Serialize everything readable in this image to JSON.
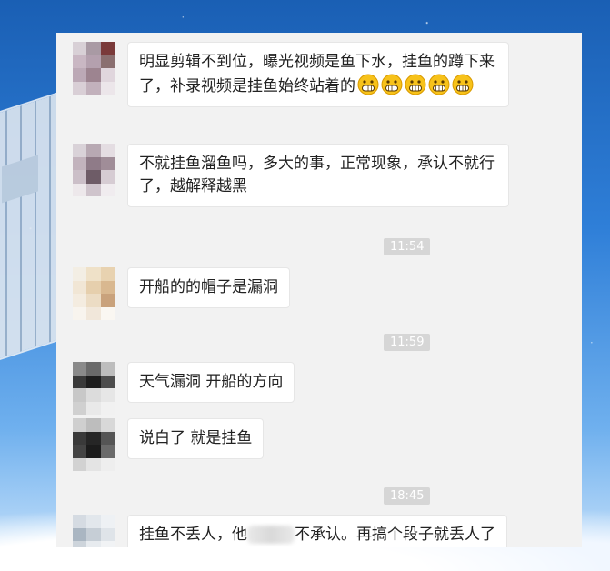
{
  "chat": {
    "messages": [
      {
        "text": "明显剪辑不到位，曝光视频是鱼下水，挂鱼的蹲下来了，补录视频是挂鱼始终站着的",
        "emoji": "grinning-face-emoji",
        "emoji_count": 5
      },
      {
        "text": "不就挂鱼溜鱼吗，多大的事，正常现象，承认不就行了，越解释越黑"
      },
      {
        "time": "11:54"
      },
      {
        "text": "开船的的帽子是漏洞"
      },
      {
        "time": "11:59"
      },
      {
        "text": "天气漏洞 开船的方向"
      },
      {
        "text": "说白了 就是挂鱼"
      },
      {
        "time": "18:45"
      },
      {
        "text_before": "挂鱼不丢人，他",
        "text_after": "不承认。再搞个段子就丢人了"
      }
    ]
  },
  "colors": {
    "panel_bg": "#f2f2f2",
    "bubble_bg": "#ffffff",
    "timestamp_bg": "#d6d6d6",
    "emoji_yellow": "#f7c21a"
  }
}
